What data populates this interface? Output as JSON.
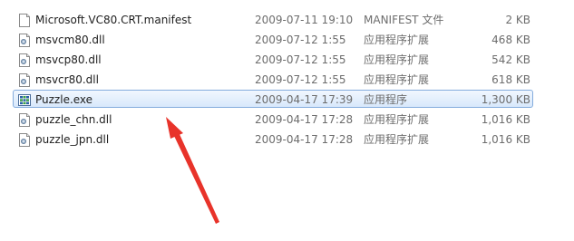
{
  "files": [
    {
      "name": "Microsoft.VC80.CRT.manifest",
      "date": "2009-07-11 19:10",
      "type": "MANIFEST 文件",
      "size": "2 KB",
      "icon": "document-icon",
      "selected": false
    },
    {
      "name": "msvcm80.dll",
      "date": "2009-07-12 1:55",
      "type": "应用程序扩展",
      "size": "468 KB",
      "icon": "dll-icon",
      "selected": false
    },
    {
      "name": "msvcp80.dll",
      "date": "2009-07-12 1:55",
      "type": "应用程序扩展",
      "size": "542 KB",
      "icon": "dll-icon",
      "selected": false
    },
    {
      "name": "msvcr80.dll",
      "date": "2009-07-12 1:55",
      "type": "应用程序扩展",
      "size": "618 KB",
      "icon": "dll-icon",
      "selected": false
    },
    {
      "name": "Puzzle.exe",
      "date": "2009-04-17 17:39",
      "type": "应用程序",
      "size": "1,300 KB",
      "icon": "puzzle-app-icon",
      "selected": true
    },
    {
      "name": "puzzle_chn.dll",
      "date": "2009-04-17 17:28",
      "type": "应用程序扩展",
      "size": "1,016 KB",
      "icon": "dll-icon",
      "selected": false
    },
    {
      "name": "puzzle_jpn.dll",
      "date": "2009-04-17 17:28",
      "type": "应用程序扩展",
      "size": "1,016 KB",
      "icon": "dll-icon",
      "selected": false
    }
  ],
  "colors": {
    "selection_border": "#84acdd",
    "selection_fill": "#d8e8fb",
    "secondary_text": "#6d6d6d",
    "annotation_arrow": "#e8332a"
  }
}
